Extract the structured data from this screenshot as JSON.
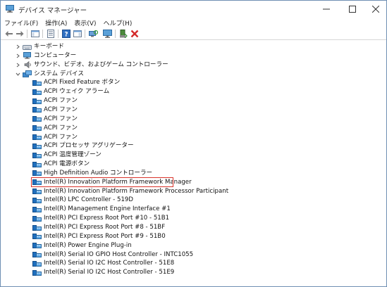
{
  "window": {
    "title": "デバイス マネージャー",
    "controls": {
      "minimize": "—",
      "maximize": "☐",
      "close": "✕"
    }
  },
  "menu": [
    {
      "label": "ファイル(F)"
    },
    {
      "label": "操作(A)"
    },
    {
      "label": "表示(V)"
    },
    {
      "label": "ヘルプ(H)"
    }
  ],
  "toolbar": [
    "back-icon",
    "forward-icon",
    "show-hide-console-tree-icon",
    "properties-icon",
    "help-icon",
    "action-pane-icon",
    "scan-hardware-icon",
    "monitor-icon",
    "enable-device-icon",
    "uninstall-device-icon"
  ],
  "tree": {
    "collapsed_categories": [
      {
        "label": "キーボード",
        "icon": "keyboard-icon"
      },
      {
        "label": "コンピューター",
        "icon": "computer-icon"
      },
      {
        "label": "サウンド、ビデオ、およびゲーム コントローラー",
        "icon": "speaker-icon"
      }
    ],
    "expanded_category": {
      "label": "システム デバイス",
      "icon": "system-devices-icon"
    },
    "devices": [
      "ACPI Fixed Feature ボタン",
      "ACPI ウェイク アラーム",
      "ACPI ファン",
      "ACPI ファン",
      "ACPI ファン",
      "ACPI ファン",
      "ACPI ファン",
      "ACPI プロセッサ アグリゲーター",
      "ACPI 温度管理ゾーン",
      "ACPI 電源ボタン",
      "High Definition Audio コントローラー",
      "Intel(R) Innovation Platform Framework Manager",
      "Intel(R) Innovation Platform Framework Processor Participant",
      "Intel(R) LPC Controller - 519D",
      "Intel(R) Management Engine Interface #1",
      "Intel(R) PCI Express Root Port #10 - 51B1",
      "Intel(R) PCI Express Root Port #8 - 51BF",
      "Intel(R) PCI Express Root Port #9 - 51B0",
      "Intel(R) Power Engine Plug-in",
      "Intel(R) Serial IO GPIO Host Controller - INTC1055",
      "Intel(R) Serial IO I2C Host Controller - 51E8",
      "Intel(R) Serial IO I2C Host Controller - 51E9"
    ],
    "highlighted_device": "Intel(R) Innovation Platform Framework Manager",
    "highlight_color": "#d9342b"
  }
}
